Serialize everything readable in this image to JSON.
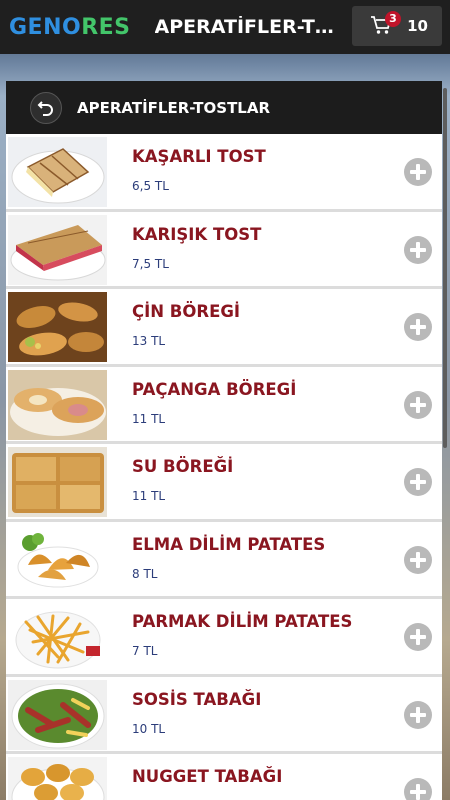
{
  "header": {
    "logo_left": "GENO",
    "logo_right": "RES",
    "title": "APERATİFLER-TOSTLAR",
    "cart_count": "3",
    "cart_total": "10"
  },
  "panel": {
    "title": "APERATİFLER-TOSTLAR"
  },
  "items": [
    {
      "name": "KAŞARLI TOST",
      "price": "6,5 TL"
    },
    {
      "name": "KARIŞIK TOST",
      "price": "7,5 TL"
    },
    {
      "name": "ÇİN BÖREGİ",
      "price": "13 TL"
    },
    {
      "name": "PAÇANGA BÖREGİ",
      "price": "11 TL"
    },
    {
      "name": "SU BÖREĞİ",
      "price": "11 TL"
    },
    {
      "name": "ELMA DİLİM PATATES",
      "price": "8 TL"
    },
    {
      "name": "PARMAK DİLİM PATATES",
      "price": "7 TL"
    },
    {
      "name": "SOSİS TABAĞI",
      "price": "10 TL"
    },
    {
      "name": "NUGGET TABAĞI",
      "price": ""
    }
  ],
  "colors": {
    "topbar": "#1f1f1f",
    "item_name": "#8a1620",
    "item_price": "#2c3d7a",
    "badge": "#c0142a",
    "add_button": "#b9b9b9"
  }
}
